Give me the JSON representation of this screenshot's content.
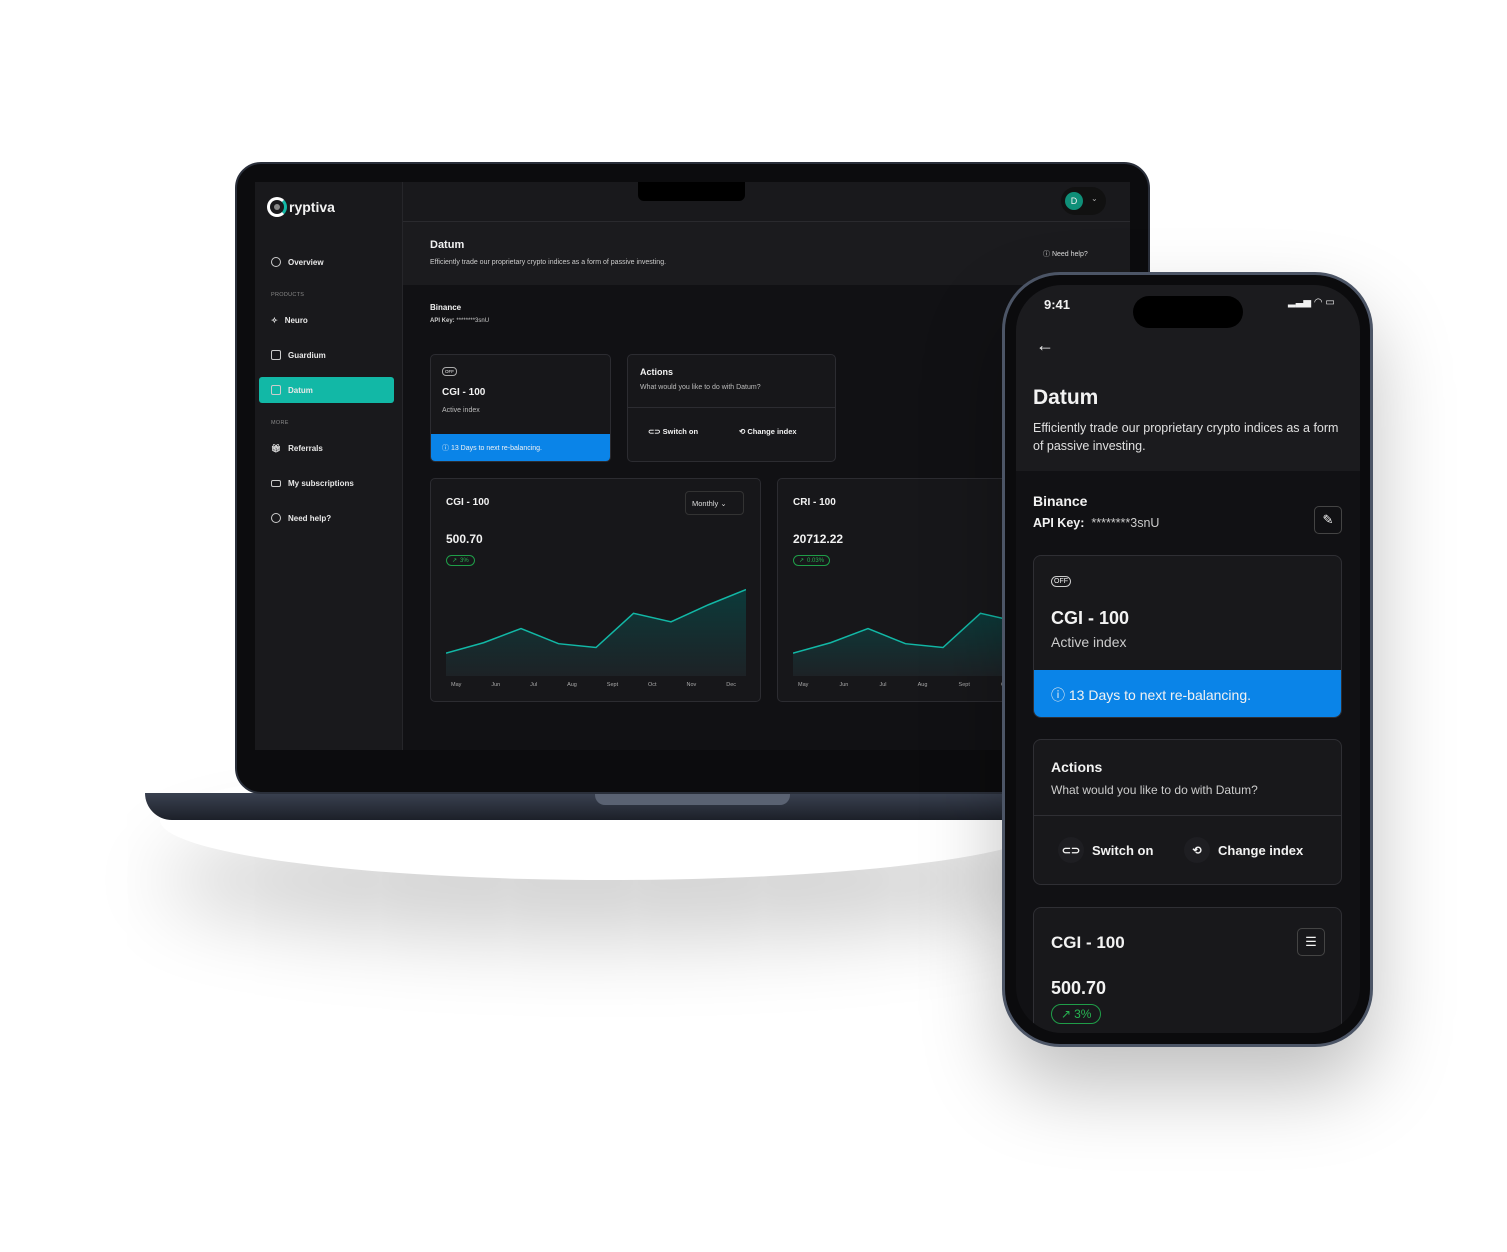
{
  "brand": {
    "name": "ryptiva",
    "accent": "#12b8a6",
    "info_blue": "#0a84e8",
    "positive_green": "#27b552"
  },
  "sidebar": {
    "overview": "Overview",
    "products_heading": "PRODUCTS",
    "items": [
      {
        "label": "Neuro"
      },
      {
        "label": "Guardium"
      },
      {
        "label": "Datum"
      }
    ],
    "more_heading": "MORE",
    "more_items": [
      {
        "label": "Referrals"
      },
      {
        "label": "My subscriptions"
      },
      {
        "label": "Need help?"
      }
    ]
  },
  "user": {
    "initial": "D"
  },
  "page": {
    "title": "Datum",
    "subtitle": "Efficiently trade our proprietary crypto indices as a form of passive investing.",
    "help": "Need help?"
  },
  "exchange": {
    "name": "Binance",
    "api_key_label": "API Key:",
    "api_key": "********3snU"
  },
  "index_card": {
    "status_icon": "OFF",
    "name": "CGI - 100",
    "status": "Active index",
    "notice": "13 Days to next re-balancing."
  },
  "actions": {
    "title": "Actions",
    "subtitle": "What would you like to do with Datum?",
    "switch_on": "Switch on",
    "change_index": "Change index"
  },
  "charts": [
    {
      "name": "CGI - 100",
      "value": "500.70",
      "change": "3%",
      "period": "Monthly",
      "months": [
        "May",
        "Jun",
        "Jul",
        "Aug",
        "Sept",
        "Oct",
        "Nov",
        "Dec"
      ],
      "series": [
        24,
        35,
        50,
        34,
        30,
        66,
        57,
        75,
        91
      ]
    },
    {
      "name": "CRI - 100",
      "value": "20712.22",
      "change": "0.03%",
      "months": [
        "May",
        "Jun",
        "Jul",
        "Aug",
        "Sept",
        "Oc"
      ],
      "series": [
        24,
        35,
        50,
        34,
        30,
        66,
        57
      ]
    }
  ],
  "phone": {
    "time": "9:41"
  }
}
